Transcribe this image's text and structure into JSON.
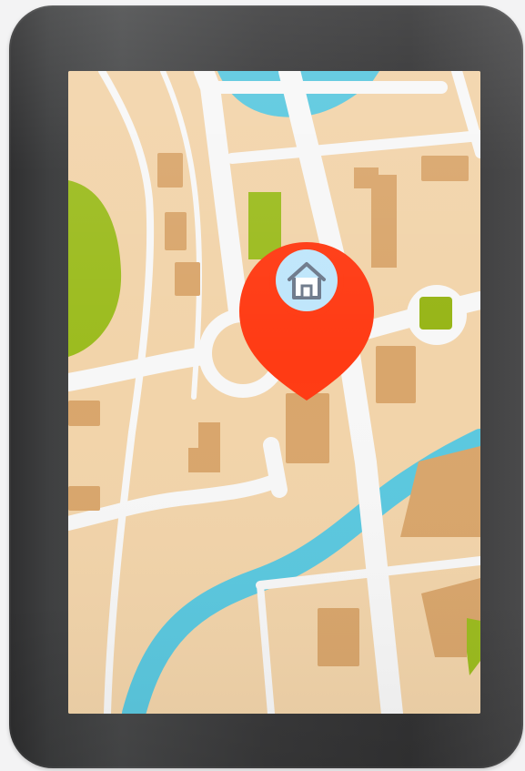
{
  "scene": {
    "type": "tablet-map-illustration"
  },
  "device": {
    "color": "#3a3a3b"
  },
  "map": {
    "land_color": "#f2d4aa",
    "road_color": "#f7f7f7",
    "water_color": "#5bc8df",
    "park_color": "#9cbc1f",
    "building_color": "#d9a66c"
  },
  "marker": {
    "icon": "home-icon",
    "pin_color": "#ff3b14",
    "inner_color": "#bfe6fb"
  },
  "poi": {
    "icon": "green-square-icon",
    "color": "#97b517"
  }
}
